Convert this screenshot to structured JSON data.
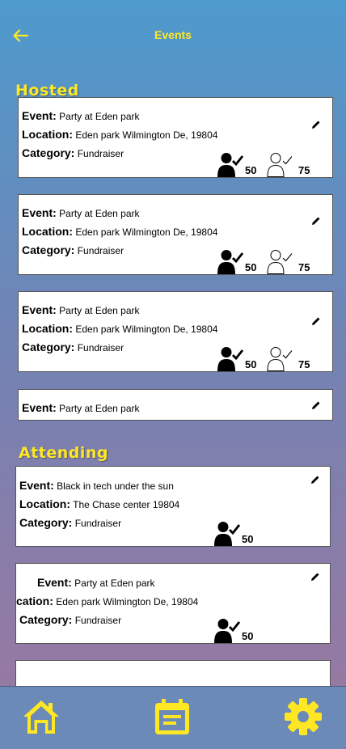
{
  "header": {
    "title": "Events"
  },
  "sections": {
    "hosted": "Hosted",
    "attending": "Attending"
  },
  "labels": {
    "event": "Event:",
    "location": "Location:",
    "location_cut": "cation:",
    "category": "Category:"
  },
  "hosted": [
    {
      "event": "Party at Eden park",
      "location": "Eden park Wilmington De, 19804",
      "category": "Fundraiser",
      "attending_count": "50",
      "invited_count": "75"
    },
    {
      "event": "Party at Eden park",
      "location": "Eden park Wilmington De, 19804",
      "category": "Fundraiser",
      "attending_count": "50",
      "invited_count": "75"
    },
    {
      "event": "Party at Eden park",
      "location": "Eden park Wilmington De, 19804",
      "category": "Fundraiser",
      "attending_count": "50",
      "invited_count": "75"
    },
    {
      "event": "Party at Eden park"
    }
  ],
  "attending": [
    {
      "event": "Black in tech under the sun",
      "location": "The Chase center  19804",
      "category": "Fundraiser",
      "attending_count": "50"
    },
    {
      "event": "Party at Eden park",
      "location": "Eden park Wilmington De, 19804",
      "category": "Fundraiser",
      "attending_count": "50"
    }
  ],
  "colors": {
    "accent": "#ffe823",
    "nav_bar": "#6b8ab7"
  },
  "icons": {
    "back": "arrow-left-icon",
    "edit": "pencil-icon",
    "attending": "user-check-filled-icon",
    "invited": "user-check-outline-icon",
    "home": "home-icon",
    "events": "calendar-icon",
    "settings": "gear-icon"
  }
}
